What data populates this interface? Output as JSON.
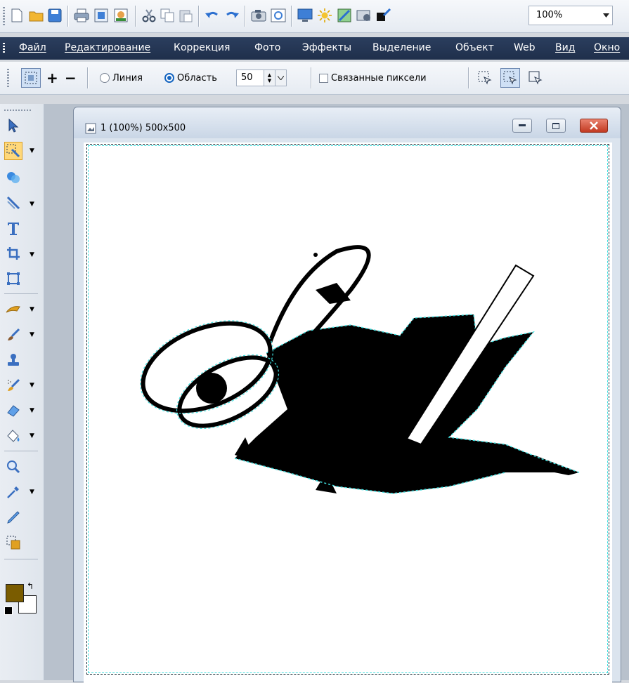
{
  "toolbar": {
    "icons": [
      "new-icon",
      "open-icon",
      "save-icon",
      "print-icon",
      "image-properties-icon",
      "image-icon",
      "cut-icon",
      "copy-icon",
      "paste-icon",
      "undo-icon",
      "redo-icon",
      "camera-icon",
      "scanner-icon",
      "monitor-icon",
      "brightness-icon",
      "enhance-icon",
      "settings-icon",
      "color-picker-icon"
    ],
    "zoom_value": "100%"
  },
  "menu": {
    "items": [
      "Файл",
      "Редактирование",
      "Коррекция",
      "Фото",
      "Эффекты",
      "Выделение",
      "Объект",
      "Web",
      "Вид",
      "Окно"
    ]
  },
  "options": {
    "radio_line": "Линия",
    "radio_area": "Область",
    "tolerance": "50",
    "linked_pixels": "Связанные пиксели"
  },
  "tools": [
    "pointer-icon",
    "magic-wand-icon",
    "shape-icon",
    "line-icon",
    "text-icon",
    "crop-icon",
    "transform-icon",
    "brush-icon",
    "paint-icon",
    "stamp-icon",
    "spray-icon",
    "eraser-icon",
    "fill-icon",
    "zoom-icon",
    "eyedropper-icon",
    "pencil-icon",
    "layer-icon"
  ],
  "colors": {
    "foreground": "#7a5c00",
    "background": "#ffffff",
    "accent": "#1565c0",
    "menubar": "#24365a"
  },
  "document": {
    "title": "1 (100%) 500x500"
  }
}
